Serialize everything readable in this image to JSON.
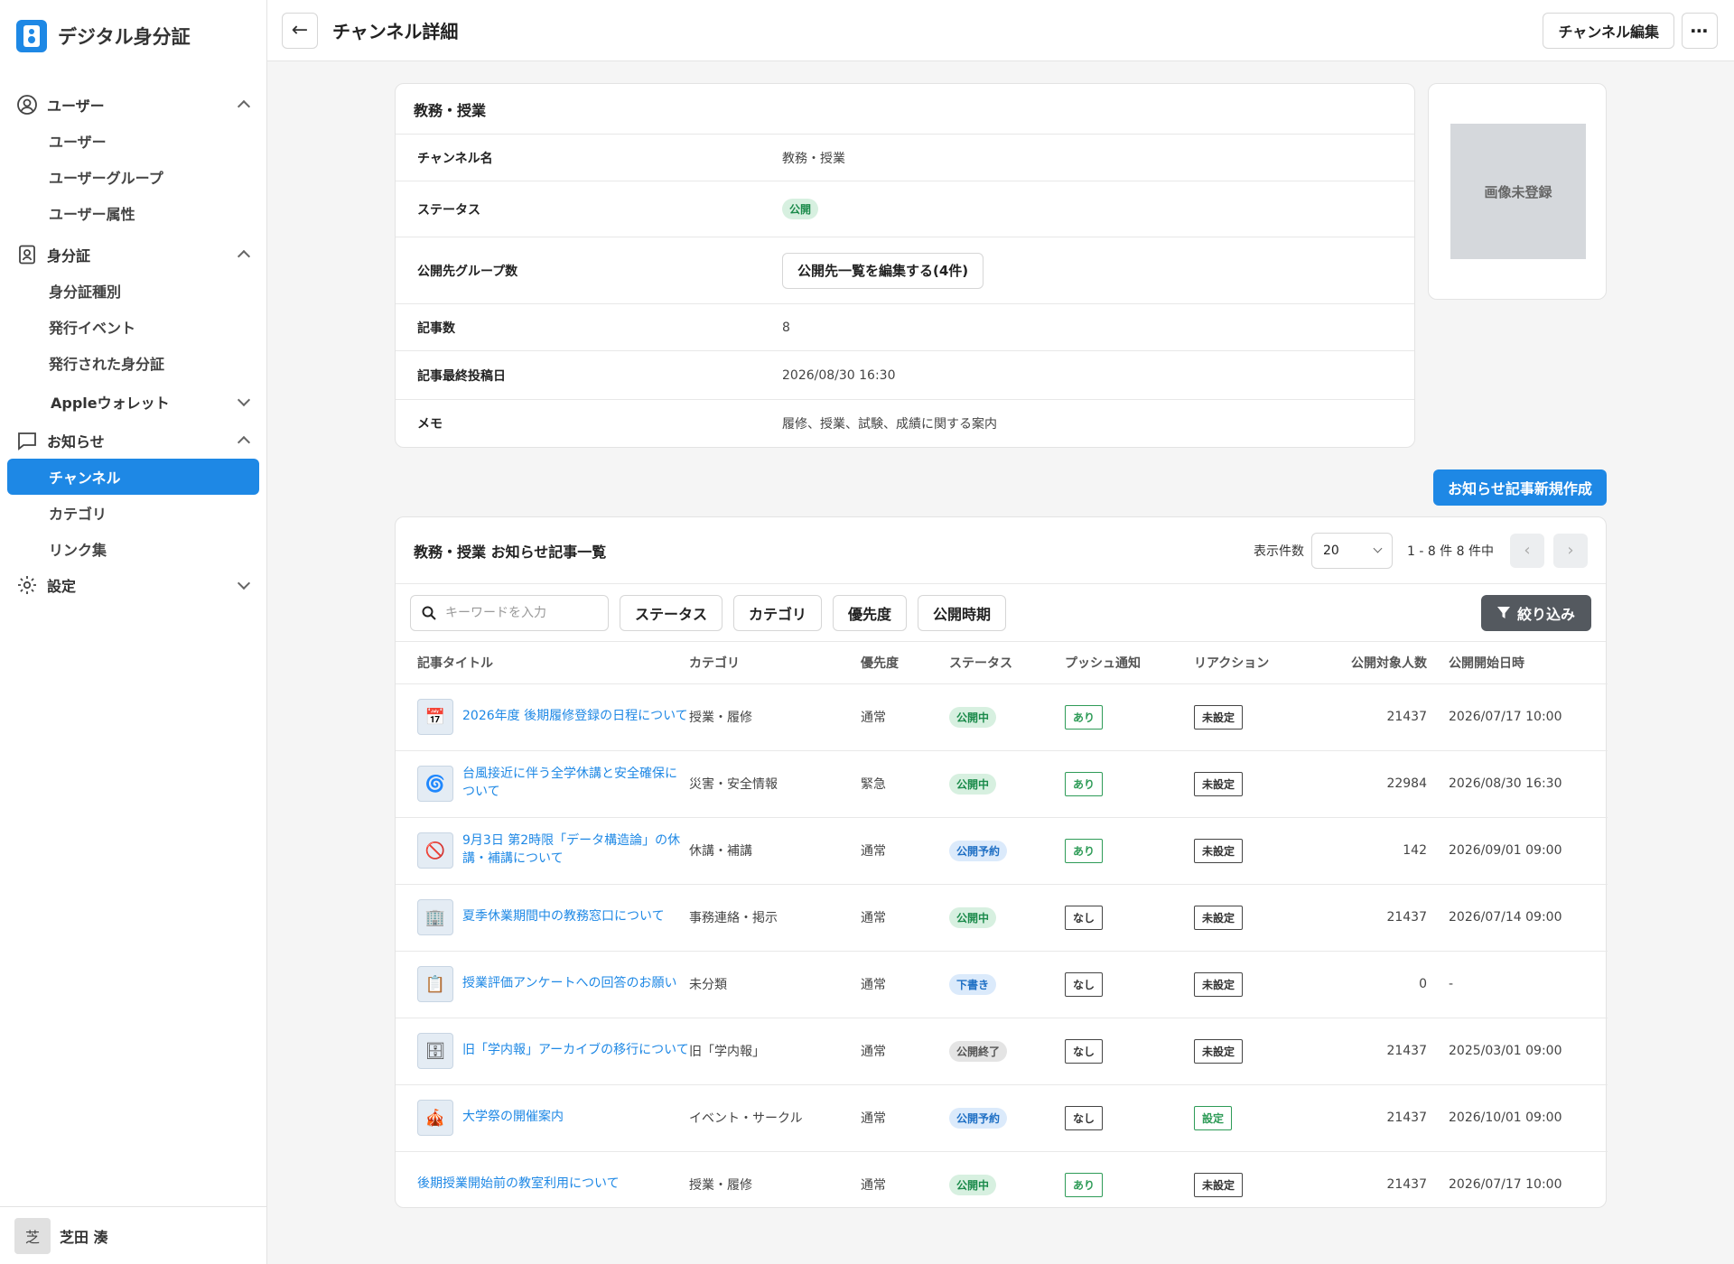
{
  "brand": {
    "name": "デジタル身分証"
  },
  "sidebar": {
    "groups": [
      {
        "label": "ユーザー",
        "items": [
          "ユーザー",
          "ユーザーグループ",
          "ユーザー属性"
        ]
      },
      {
        "label": "身分証",
        "items": [
          "身分証種別",
          "発行イベント",
          "発行された身分証"
        ],
        "sub": "Appleウォレット"
      },
      {
        "label": "お知らせ",
        "items": [
          "チャンネル",
          "カテゴリ",
          "リンク集"
        ]
      },
      {
        "label": "設定"
      }
    ],
    "user": {
      "initial": "芝",
      "name": "芝田 湊"
    }
  },
  "header": {
    "title": "チャンネル詳細",
    "edit_label": "チャンネル編集",
    "more_label": "⋯"
  },
  "detail": {
    "title": "教務・授業",
    "rows": [
      {
        "label": "チャンネル名",
        "value": "教務・授業"
      },
      {
        "label": "ステータス",
        "value": "公開"
      },
      {
        "label": "公開先グループ数",
        "value": "公開先一覧を編集する(4件)"
      },
      {
        "label": "記事数",
        "value": "8"
      },
      {
        "label": "記事最終投稿日",
        "value": "2026/08/30 16:30"
      },
      {
        "label": "メモ",
        "value": "履修、授業、試験、成績に関する案内"
      }
    ]
  },
  "image": {
    "placeholder": "画像未登録"
  },
  "new_article_label": "お知らせ記事新規作成",
  "list": {
    "title": "教務・授業 お知らせ記事一覧",
    "per_page_label": "表示件数",
    "per_page": "20",
    "range": "1 - 8 件 8 件中",
    "search_placeholder": "キーワードを入力",
    "filters": [
      "ステータス",
      "カテゴリ",
      "優先度",
      "公開時期"
    ],
    "filter_button": "絞り込み",
    "columns": [
      "記事タイトル",
      "カテゴリ",
      "優先度",
      "ステータス",
      "プッシュ通知",
      "リアクション",
      "公開対象人数",
      "公開開始日時"
    ],
    "rows": [
      {
        "title": "2026年度 後期履修登録の日程について",
        "icon": "calendar-icon",
        "category": "授業・履修",
        "priority": "通常",
        "status": "公開中",
        "push": "あり",
        "reaction": "未設定",
        "count": "21437",
        "date": "2026/07/17 10:00"
      },
      {
        "title": "台風接近に伴う全学休講と安全確保について",
        "icon": "typhoon-icon",
        "category": "災害・安全情報",
        "priority": "緊急",
        "status": "公開中",
        "push": "あり",
        "reaction": "未設定",
        "count": "22984",
        "date": "2026/08/30 16:30"
      },
      {
        "title": "9月3日 第2時限「データ構造論」の休講・補講について",
        "icon": "cancel-sign-icon",
        "category": "休講・補講",
        "priority": "通常",
        "status": "公開予約",
        "push": "あり",
        "reaction": "未設定",
        "count": "142",
        "date": "2026/09/01 09:00"
      },
      {
        "title": "夏季休業期間中の教務窓口について",
        "icon": "counter-icon",
        "category": "事務連絡・掲示",
        "priority": "通常",
        "status": "公開中",
        "push": "なし",
        "reaction": "未設定",
        "count": "21437",
        "date": "2026/07/14 09:00"
      },
      {
        "title": "授業評価アンケートへの回答のお願い",
        "icon": "survey-icon",
        "category": "未分類",
        "priority": "通常",
        "status": "下書き",
        "push": "なし",
        "reaction": "未設定",
        "count": "0",
        "date": "-"
      },
      {
        "title": "旧「学内報」アーカイブの移行について",
        "icon": "archive-icon",
        "category": "旧「学内報」",
        "priority": "通常",
        "status": "公開終了",
        "push": "なし",
        "reaction": "未設定",
        "count": "21437",
        "date": "2025/03/01 09:00"
      },
      {
        "title": "大学祭の開催案内",
        "icon": "festival-icon",
        "category": "イベント・サークル",
        "priority": "通常",
        "status": "公開予約",
        "push": "なし",
        "reaction": "設定",
        "count": "21437",
        "date": "2026/10/01 09:00"
      },
      {
        "title": "後期授業開始前の教室利用について",
        "icon": "",
        "category": "授業・履修",
        "priority": "通常",
        "status": "公開中",
        "push": "あり",
        "reaction": "未設定",
        "count": "21437",
        "date": "2026/07/17 10:00"
      }
    ]
  }
}
